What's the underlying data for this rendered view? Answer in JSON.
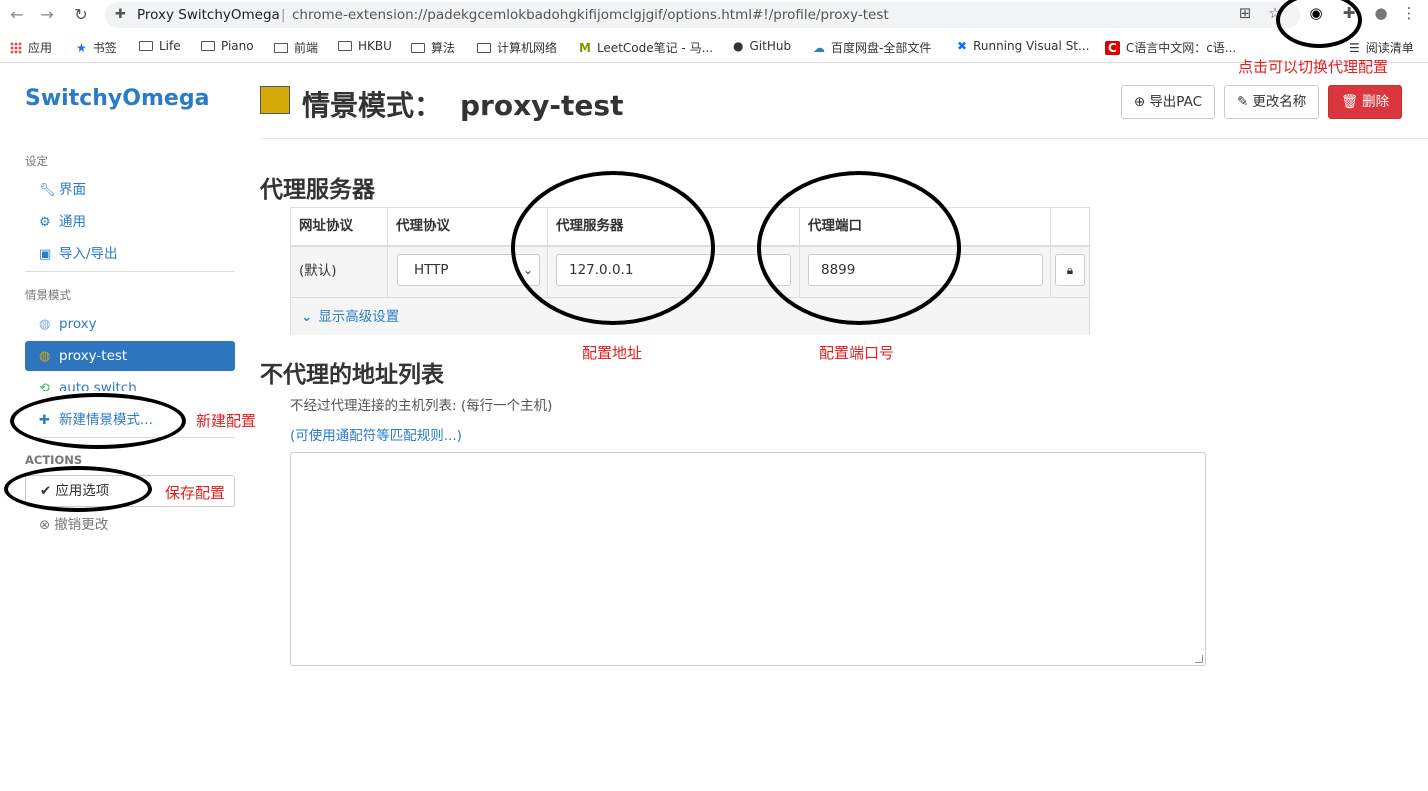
{
  "browser": {
    "site_name": "Proxy SwitchyOmega",
    "url": "chrome-extension://padekgcemlokbadohgkifijomclgjgif/options.html#!/profile/proxy-test"
  },
  "bookmarks": [
    {
      "label": "应用"
    },
    {
      "label": "书签"
    },
    {
      "label": "Life"
    },
    {
      "label": "Piano"
    },
    {
      "label": "前端"
    },
    {
      "label": "HKBU"
    },
    {
      "label": "算法"
    },
    {
      "label": "计算机网络"
    },
    {
      "label": "LeetCode笔记 - 马..."
    },
    {
      "label": "GitHub"
    },
    {
      "label": "百度网盘-全部文件"
    },
    {
      "label": "Running Visual St..."
    },
    {
      "label": "C语言中文网：c语..."
    },
    {
      "label": "阅读清单"
    }
  ],
  "sidebar": {
    "brand": "SwitchyOmega",
    "settings_header": "设定",
    "settings_items": [
      "界面",
      "通用",
      "导入/导出"
    ],
    "profiles_header": "情景模式",
    "profiles": [
      "proxy",
      "proxy-test",
      "auto switch"
    ],
    "new_profile": "新建情景模式...",
    "actions_header": "ACTIONS",
    "apply": "应用选项",
    "discard": "撤销更改"
  },
  "header": {
    "title_prefix": "情景模式：",
    "profile_name": "proxy-test",
    "profile_color": "#d4a90a",
    "export_pac": "导出PAC",
    "rename": "更改名称",
    "delete": "删除"
  },
  "proxy_servers": {
    "title": "代理服务器",
    "columns": [
      "网址协议",
      "代理协议",
      "代理服务器",
      "代理端口"
    ],
    "row": {
      "scheme": "(默认)",
      "protocol": "HTTP",
      "server": "127.0.0.1",
      "port": "8899"
    },
    "advanced": "显示高级设置"
  },
  "bypass": {
    "title": "不代理的地址列表",
    "hint": "不经过代理连接的主机列表: (每行一个主机)",
    "wildcard_link": "(可使用通配符等匹配规则...)"
  },
  "annotations": {
    "toolbar_switch": "点击可以切换代理配置",
    "server_addr": "配置地址",
    "server_port": "配置端口号",
    "new_config": "新建配置",
    "save_config": "保存配置"
  }
}
